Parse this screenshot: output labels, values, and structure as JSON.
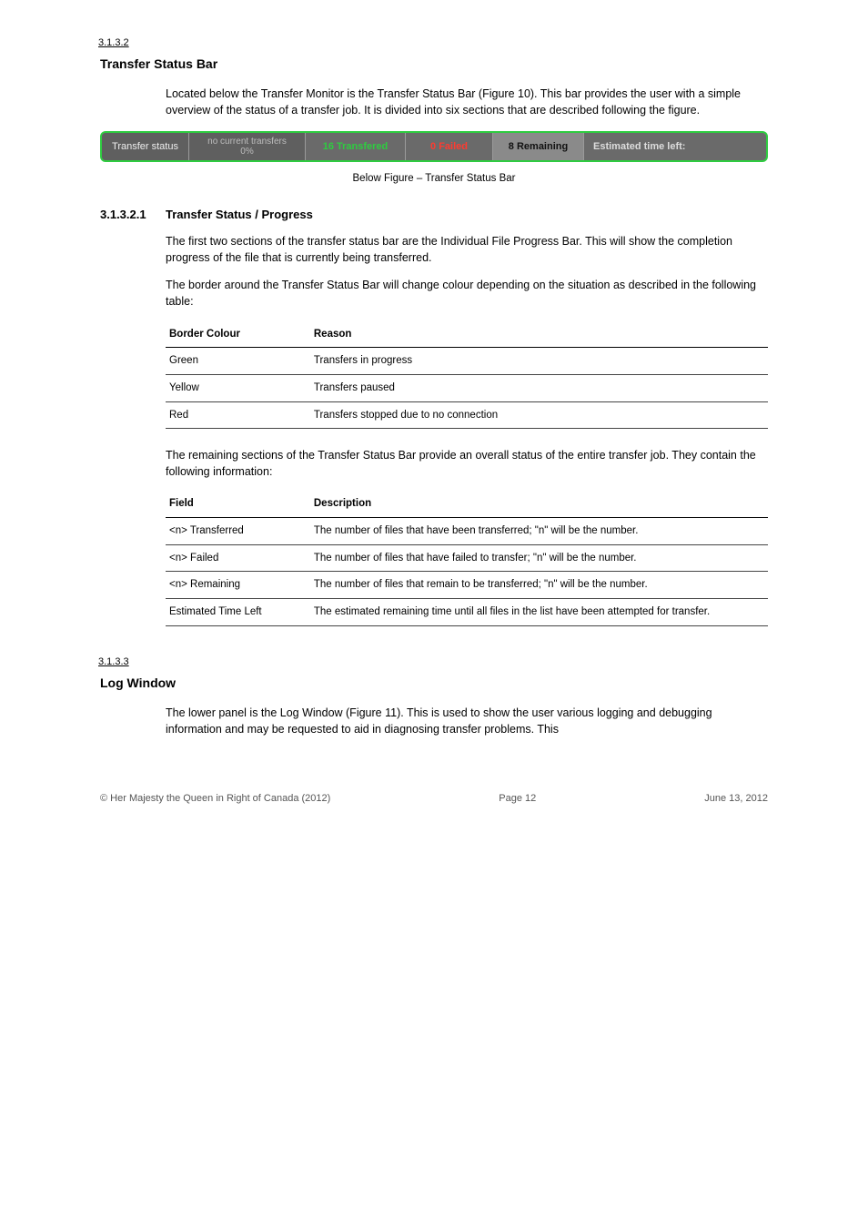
{
  "section": {
    "num": "3.1.3.2",
    "title": "Transfer Status Bar",
    "intro": "Located below the Transfer Monitor is the Transfer Status Bar (Figure 10). This bar provides the user with a simple overview of the status of a transfer job. It is divided into six sections that are described following the figure."
  },
  "figure": {
    "below": "Below Figure – Transfer Status Bar",
    "statusbar": {
      "label": "Transfer status",
      "noTransfers": "no current transfers",
      "pct": "0%",
      "transfered": "16 Transfered",
      "failed": "0 Failed",
      "remaining": "8 Remaining",
      "eta": "Estimated time left:"
    }
  },
  "sub": {
    "num": "3.1.3.2.1",
    "title": "Transfer Status / Progress",
    "p1": "The first two sections of the transfer status bar are the Individual File Progress Bar. This will show the completion progress of the file that is currently being transferred.",
    "p2": "The border around the Transfer Status Bar will change colour depending on the situation as described in the following table:",
    "p3": "The remaining sections of the Transfer Status Bar provide an overall status of the entire transfer job. They contain the following information:"
  },
  "table1": {
    "headers": [
      "Border Colour",
      "Reason"
    ],
    "rows": [
      [
        "Green",
        "Transfers in progress"
      ],
      [
        "Yellow",
        "Transfers paused"
      ],
      [
        "Red",
        "Transfers stopped due to no connection"
      ]
    ]
  },
  "table2": {
    "headers": [
      "Field",
      "Description"
    ],
    "rows": [
      [
        "<n> Transferred",
        "The number of files that have been transferred; \"n\" will be the number."
      ],
      [
        "<n> Failed",
        "The number of files that have failed to transfer; \"n\" will be the number."
      ],
      [
        "<n> Remaining",
        "The number of files that remain to be transferred; \"n\" will be the number."
      ],
      [
        "Estimated Time Left",
        "The estimated remaining time until all files in the list have been attempted for transfer."
      ]
    ]
  },
  "section2": {
    "num": "3.1.3.3",
    "title": "Log Window",
    "p": "The lower panel is the Log Window (Figure 11). This is used to show the user various logging and debugging information and may be requested to aid in diagnosing transfer problems. This"
  },
  "footer": {
    "left": "© Her Majesty the Queen in Right of Canada (2012)",
    "mid": "Page 12",
    "right": "June 13, 2012"
  }
}
